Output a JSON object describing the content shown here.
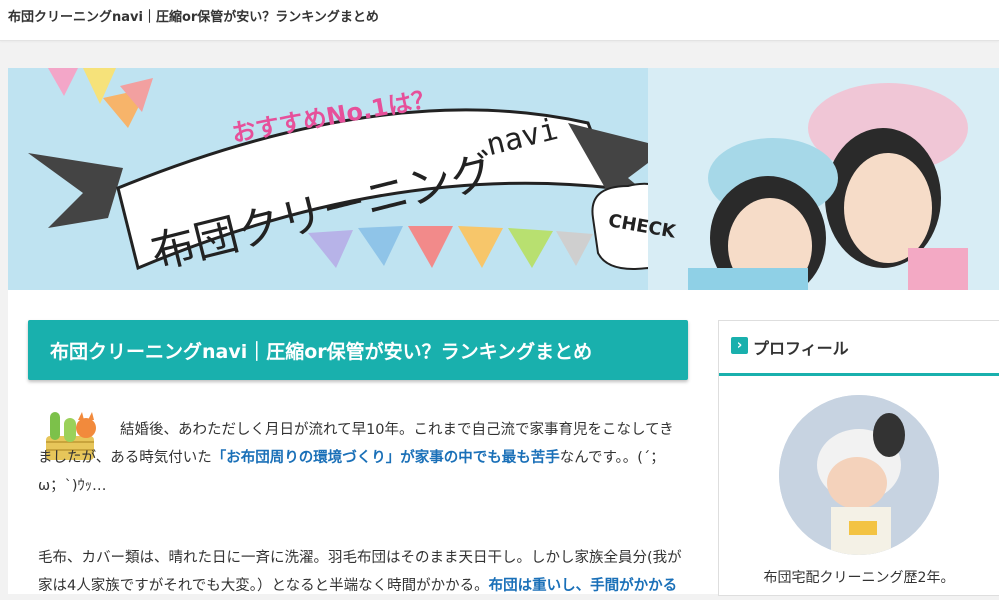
{
  "header": {
    "site_title": "布団クリーニングnavi｜圧縮or保管が安い？ランキングまとめ"
  },
  "banner": {
    "tagline": "おすすめNo.1は？",
    "logo_main": "布団クリーニング",
    "logo_sub": "navi",
    "bubble": "CHECK",
    "colors": {
      "sky": "#bfe3f1",
      "pink": "#e6509a",
      "ribbon": "#ffffff"
    }
  },
  "article": {
    "title": "布団クリーニングnavi｜圧縮or保管が安い？ランキングまとめ",
    "p1_a": "結婚後、あわただしく月日が流れて早10年。これまで自己流で家事育児をこなしてきましたが、ある時気付いた",
    "p1_hl": "「お布団周りの環境づくり」が家事の中でも最も苦手",
    "p1_b": "なんです。。(´；ω；`)ｳｯ…",
    "p2_a": "毛布、カバー類は、晴れた日に一斉に洗濯。羽毛布団はそのまま天日干し。しかし家族全員分(我が家は4人家族ですがそれでも大変。）となると半端なく時間がかかる。",
    "p2_hl": "布団は重いし、手間がかかる"
  },
  "sidebar": {
    "heading": "プロフィール",
    "caption": "布団宅配クリーニング歴2年。",
    "accent": "#19b0ad"
  }
}
